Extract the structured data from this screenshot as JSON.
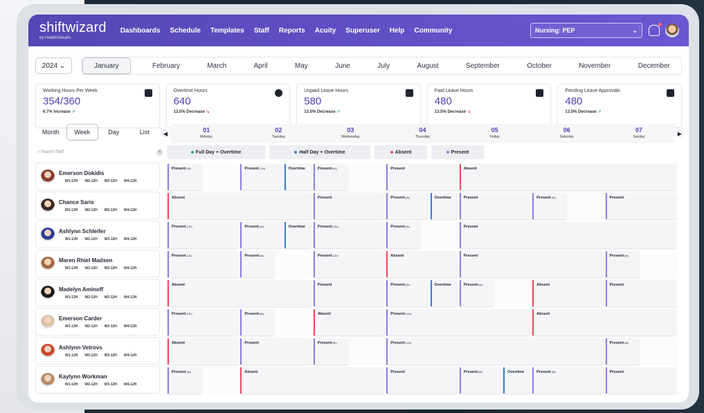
{
  "app": {
    "logo": "shiftwizard",
    "logo_sub": "by HealthStream.",
    "department": "Nursing: PEP"
  },
  "nav": [
    "Dashboards",
    "Schedule",
    "Templates",
    "Staff",
    "Reports",
    "Acuity",
    "Superuser",
    "Help",
    "Community"
  ],
  "year": "2024",
  "months": [
    "January",
    "February",
    "March",
    "April",
    "May",
    "June",
    "July",
    "August",
    "September",
    "October",
    "November",
    "December"
  ],
  "active_month": "January",
  "kpis": [
    {
      "title": "Working Hours Per Week",
      "value": "354/360",
      "change": "6.7% Increase",
      "trend": "up",
      "icon": "briefcase-icon"
    },
    {
      "title": "Overtime Hours",
      "value": "640",
      "change": "13.5% Decrease",
      "trend": "down",
      "icon": "clock-icon"
    },
    {
      "title": "Unpaid Leave Hours",
      "value": "580",
      "change": "13.5% Decrease",
      "trend": "up",
      "icon": "money-icon"
    },
    {
      "title": "Paid Leave Hours",
      "value": "480",
      "change": "13.5% Decrease",
      "trend": "down",
      "icon": "paid-icon"
    },
    {
      "title": "Pending Leave Approvals",
      "value": "480",
      "change": "13.5% Decrease",
      "trend": "up",
      "icon": "approval-icon"
    }
  ],
  "views": [
    "Month",
    "Week",
    "Day",
    "List"
  ],
  "active_view": "Week",
  "days": [
    {
      "n": "01",
      "w": "Monday"
    },
    {
      "n": "02",
      "w": "Tuesday"
    },
    {
      "n": "03",
      "w": "Wednesday"
    },
    {
      "n": "04",
      "w": "Thursday"
    },
    {
      "n": "05",
      "w": "Friday"
    },
    {
      "n": "06",
      "w": "Saturday"
    },
    {
      "n": "07",
      "w": "Sunday"
    }
  ],
  "search_placeholder": "Search Staff",
  "legend": [
    {
      "label": "Full Day + Overtime",
      "color": "#2ab27b"
    },
    {
      "label": "Half Day + Overtime",
      "color": "#3a7bd5"
    },
    {
      "label": "Absent",
      "color": "#e9485a"
    },
    {
      "label": "Present",
      "color": "#8a7fe0"
    }
  ],
  "weeks": [
    "W1-12H",
    "W2-12H",
    "W3-12H",
    "W4-12H"
  ],
  "colors": {
    "accent": "#5547b4",
    "present": "#8a7fe0",
    "absent": "#e9485a",
    "overtime": "#3a7bd5"
  },
  "staff": [
    {
      "name": "Emerson Dokidis",
      "av": "#8a3a2f",
      "cells": [
        [
          0,
          0.5,
          "p",
          "Present",
          "(6h)"
        ],
        [
          1,
          0.6,
          "p",
          "Present",
          "(12h)"
        ],
        [
          1.6,
          0.45,
          "o",
          "Overtime",
          ""
        ],
        [
          2,
          0.5,
          "p",
          "Present",
          "(6h)"
        ],
        [
          3,
          1,
          "p",
          "Present",
          ""
        ],
        [
          4,
          3,
          "a",
          "Absent",
          ""
        ]
      ]
    },
    {
      "name": "Chance Saris",
      "av": "#3a2a22",
      "cells": [
        [
          0,
          2,
          "a",
          "Absent",
          ""
        ],
        [
          2,
          1,
          "p",
          "Present",
          ""
        ],
        [
          3,
          0.6,
          "p",
          "Present",
          "(6h)"
        ],
        [
          3.6,
          0.4,
          "o",
          "Overtime",
          ""
        ],
        [
          4,
          1,
          "p",
          "Present",
          ""
        ],
        [
          5,
          0.5,
          "p",
          "Present",
          "(6h)"
        ],
        [
          6,
          1,
          "p",
          "Present",
          ""
        ]
      ]
    },
    {
      "name": "Ashlynn Schleifer",
      "av": "#2c3e8f",
      "cells": [
        [
          0,
          1,
          "p",
          "Present",
          "(12h)"
        ],
        [
          1,
          0.6,
          "p",
          "Present",
          "(6h)"
        ],
        [
          1.6,
          0.4,
          "o",
          "Overtime",
          ""
        ],
        [
          2,
          1,
          "p",
          "Present",
          "(12h)"
        ],
        [
          3,
          0.5,
          "p",
          "Present",
          "(6h)"
        ],
        [
          4,
          3,
          "p",
          "Present",
          ""
        ]
      ]
    },
    {
      "name": "Maren Rhiel Madsen",
      "av": "#a26a45",
      "cells": [
        [
          0,
          1,
          "p",
          "Present",
          "(12h)"
        ],
        [
          1,
          0.5,
          "p",
          "Present",
          "(6h)"
        ],
        [
          2,
          1,
          "p",
          "Present",
          "(12h)"
        ],
        [
          3,
          1,
          "a",
          "Absent",
          ""
        ],
        [
          4,
          2,
          "p",
          "Present",
          ""
        ],
        [
          6,
          0.5,
          "p",
          "Present",
          "(6h)"
        ]
      ]
    },
    {
      "name": "Madelyn Aminoff",
      "av": "#1e1a1a",
      "cells": [
        [
          0,
          2,
          "a",
          "Absent",
          ""
        ],
        [
          2,
          1,
          "p",
          "Present",
          ""
        ],
        [
          3,
          0.6,
          "p",
          "Present",
          "(6h)"
        ],
        [
          3.6,
          0.4,
          "o",
          "Overtime",
          ""
        ],
        [
          4,
          0.5,
          "p",
          "Present",
          "(6h)"
        ],
        [
          5,
          1,
          "a",
          "Absent",
          ""
        ],
        [
          6,
          1,
          "p",
          "Present",
          ""
        ]
      ]
    },
    {
      "name": "Emerson Carder",
      "av": "#d9c1a8",
      "cells": [
        [
          0,
          1,
          "p",
          "Present",
          "(12h)"
        ],
        [
          1,
          0.5,
          "p",
          "Present",
          "(6h)"
        ],
        [
          2,
          1,
          "a",
          "Absent",
          ""
        ],
        [
          3,
          2,
          "p",
          "Present",
          "(12h)"
        ],
        [
          5,
          2,
          "a",
          "Absent",
          ""
        ]
      ]
    },
    {
      "name": "Ashlynn Vetrovs",
      "av": "#c44a2a",
      "cells": [
        [
          0,
          1,
          "a",
          "Absent",
          ""
        ],
        [
          1,
          1,
          "p",
          "Present",
          ""
        ],
        [
          2,
          0.5,
          "p",
          "Present",
          "(6h)"
        ],
        [
          3,
          3,
          "p",
          "Present",
          "(12h)"
        ],
        [
          6,
          0.5,
          "p",
          "Present",
          "(6h)"
        ]
      ]
    },
    {
      "name": "Kaylynn Workman",
      "av": "#b78b6a",
      "cells": [
        [
          0,
          0.5,
          "p",
          "Present",
          "(6h)"
        ],
        [
          1,
          2,
          "a",
          "Absent",
          ""
        ],
        [
          3,
          1,
          "p",
          "Present",
          ""
        ],
        [
          4,
          0.6,
          "p",
          "Present",
          "(6h)"
        ],
        [
          4.6,
          0.4,
          "o",
          "Overtime",
          ""
        ],
        [
          5,
          1,
          "p",
          "Present",
          "(6h)"
        ],
        [
          6,
          1,
          "p",
          "Present",
          ""
        ]
      ]
    }
  ]
}
